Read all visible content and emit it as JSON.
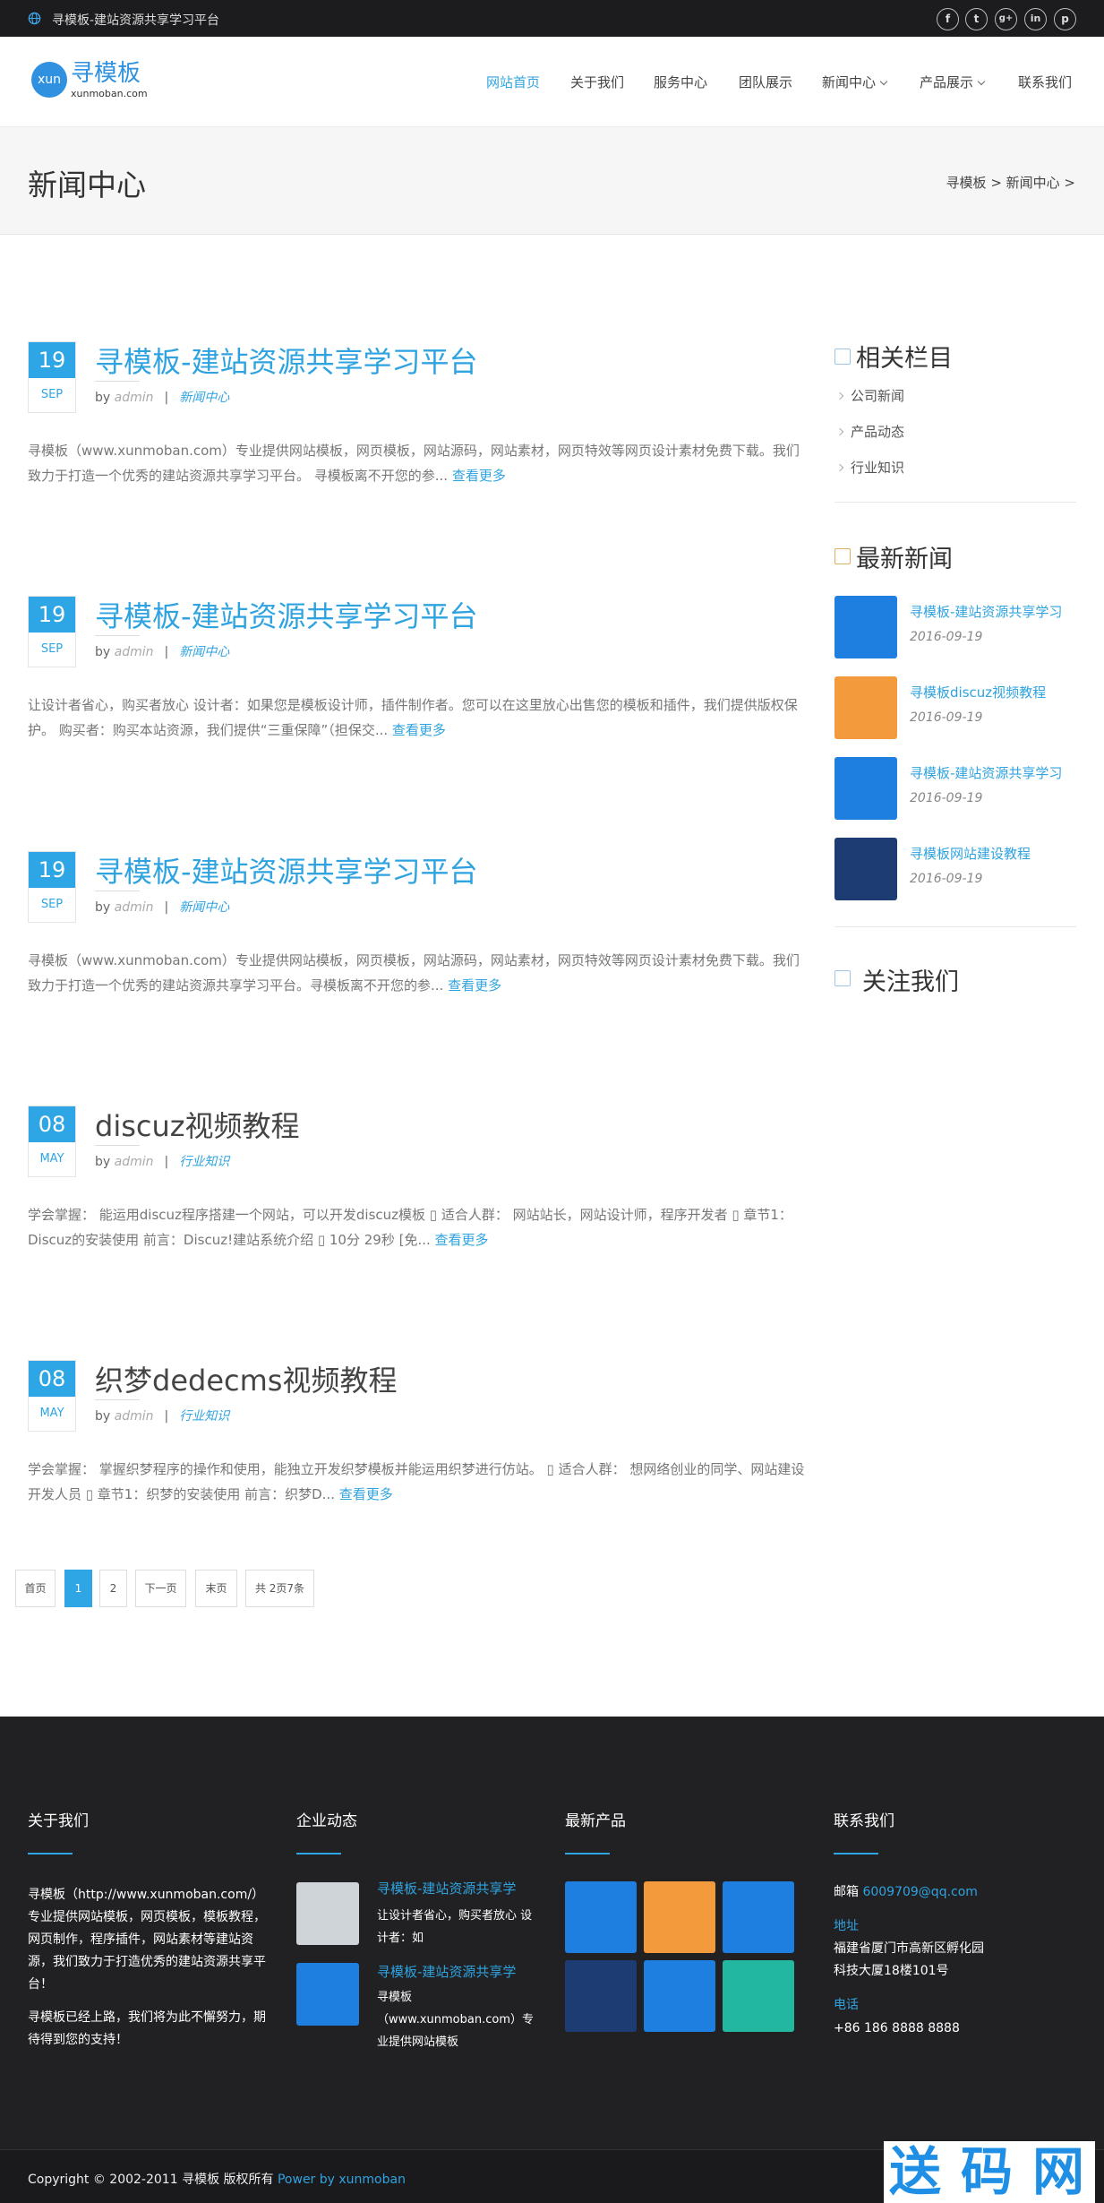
{
  "topbar": {
    "title": "寻模板-建站资源共享学习平台",
    "social": [
      "f",
      "t",
      "g+",
      "in",
      "p"
    ]
  },
  "header": {
    "logo_circle": "xun",
    "logo_text": "寻模板",
    "logo_sub": "xunmoban.com",
    "nav": [
      "网站首页",
      "关于我们",
      "服务中心",
      "团队展示",
      "新闻中心",
      "产品展示",
      "联系我们"
    ]
  },
  "banner": {
    "title": "新闻中心",
    "breadcrumb": "寻模板 > 新闻中心 >"
  },
  "posts": [
    {
      "day": "19",
      "month": "SEP",
      "title": "寻模板-建站资源共享学习平台",
      "by": "by",
      "author": "admin",
      "sep": "|",
      "category": "新闻中心",
      "excerpt": "寻模板（www.xunmoban.com）专业提供网站模板，网页模板，网站源码，网站素材，网页特效等网页设计素材免费下载。我们致力于打造一个优秀的建站资源共享学习平台。 寻模板离不开您的参...",
      "more": "查看更多"
    },
    {
      "day": "19",
      "month": "SEP",
      "title": "寻模板-建站资源共享学习平台",
      "by": "by",
      "author": "admin",
      "sep": "|",
      "category": "新闻中心",
      "excerpt": "让设计者省心，购买者放心 设计者：如果您是模板设计师，插件制作者。您可以在这里放心出售您的模板和插件，我们提供版权保护。 购买者：购买本站资源，我们提供“三重保障”（担保交...",
      "more": "查看更多"
    },
    {
      "day": "19",
      "month": "SEP",
      "title": "寻模板-建站资源共享学习平台",
      "by": "by",
      "author": "admin",
      "sep": "|",
      "category": "新闻中心",
      "excerpt": "寻模板（www.xunmoban.com）专业提供网站模板，网页模板，网站源码，网站素材，网页特效等网页设计素材免费下载。我们致力于打造一个优秀的建站资源共享学习平台。寻模板离不开您的参...",
      "more": "查看更多"
    },
    {
      "day": "08",
      "month": "MAY",
      "title": "discuz视频教程",
      "by": "by",
      "author": "admin",
      "sep": "|",
      "category": "行业知识",
      "excerpt": "学会掌握： 能运用discuz程序搭建一个网站，可以开发discuz模板 ▯ 适合人群： 网站站长，网站设计师，程序开发者 ▯ 章节1：Discuz的安装使用 前言：Discuz!建站系统介绍 ▯ 10分 29秒 [免...",
      "more": "查看更多"
    },
    {
      "day": "08",
      "month": "MAY",
      "title": "织梦dedecms视频教程",
      "by": "by",
      "author": "admin",
      "sep": "|",
      "category": "行业知识",
      "excerpt": "学会掌握： 掌握织梦程序的操作和使用，能独立开发织梦模板并能运用织梦进行仿站。 ▯ 适合人群： 想网络创业的同学、网站建设开发人员 ▯ 章节1：织梦的安装使用 前言：织梦D...",
      "more": "查看更多"
    }
  ],
  "pagination": [
    "首页",
    "1",
    "2",
    "下一页",
    "末页",
    "共 2页7条"
  ],
  "sidebar": {
    "related_title": "相关栏目",
    "related": [
      "公司新闻",
      "产品动态",
      "行业知识"
    ],
    "latest_title": "最新新闻",
    "latest": [
      {
        "title": "寻模板-建站资源共享学习",
        "date": "2016-09-19",
        "color": "#1f7fe0"
      },
      {
        "title": "寻模板discuz视频教程",
        "date": "2016-09-19",
        "color": "#f39a3c"
      },
      {
        "title": "寻模板-建站资源共享学习",
        "date": "2016-09-19",
        "color": "#1f7fe0"
      },
      {
        "title": "寻模板网站建设教程",
        "date": "2016-09-19",
        "color": "#1d3c74"
      }
    ],
    "follow_title": "关注我们",
    "follow": [
      {
        "icon": "f",
        "color": "#3b5998"
      },
      {
        "icon": "t",
        "color": "#4aa8e0"
      },
      {
        "icon": "g+",
        "color": "#d8473b"
      },
      {
        "icon": "in",
        "color": "#1b86bd"
      },
      {
        "icon": "p",
        "color": "#c2102a"
      },
      {
        "icon": "rss",
        "color": "#f5a623"
      }
    ]
  },
  "footer": {
    "about_title": "关于我们",
    "about_p1": "寻模板（http://www.xunmoban.com/）专业提供网站模板，网页模板，模板教程，网页制作，程序插件，网站素材等建站资源，我们致力于打造优秀的建站资源共享平台！",
    "about_p2": "寻模板已经上路，我们将为此不懈努力，期待得到您的支持！",
    "news_title": "企业动态",
    "news": [
      {
        "title": "寻模板-建站资源共享学",
        "text": "让设计者省心，购买者放心 设计者：如"
      },
      {
        "title": "寻模板-建站资源共享学",
        "text": "寻模板（www.xunmoban.com）专业提供网站模板"
      }
    ],
    "products_title": "最新产品",
    "products": [
      "#1f7fe0",
      "#f39a3c",
      "#1f7fe0",
      "#1d3c74",
      "#1f7fe0",
      "#22b8a0"
    ],
    "contact_title": "联系我们",
    "email_label": "邮箱",
    "email": "6009709@qq.com",
    "addr_label": "地址",
    "addr": "福建省厦门市高新区孵化园科技大厦18楼101号",
    "phone_label": "电话",
    "phone": "+86 186 8888 8888"
  },
  "copyright": {
    "text": "Copyright © 2002-2011 寻模板 版权所有",
    "power": "Power by xunmoban"
  },
  "watermark": [
    "送",
    "码",
    "网"
  ]
}
